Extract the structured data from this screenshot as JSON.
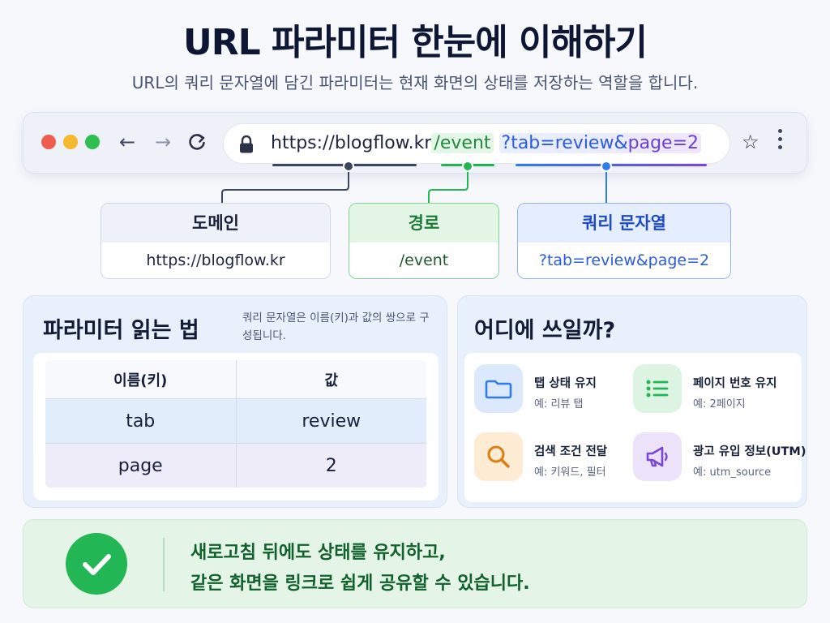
{
  "header": {
    "title": "URL 파라미터 한눈에 이해하기",
    "subtitle": "URL의 쿼리 문자열에 담긴 파라미터는 현재 화면의 상태를 저장하는 역할을 합니다."
  },
  "browser": {
    "url_domain": "https://blogflow.kr",
    "url_path": "/event",
    "url_query_start": "?tab=review&",
    "url_query_end": "page=2",
    "icons": [
      "back-arrow-icon",
      "forward-arrow-icon",
      "reload-icon",
      "lock-icon",
      "star-icon",
      "more-vert-icon"
    ]
  },
  "parts": [
    {
      "label": "도메인",
      "value": "https://blogflow.kr",
      "color": "#3d4660"
    },
    {
      "label": "경로",
      "value": "/event",
      "color": "#22b655"
    },
    {
      "label": "쿼리 문자열",
      "value": "?tab=review&page=2",
      "color": "#2f7bf0"
    }
  ],
  "reading": {
    "title": "파라미터 읽는 법",
    "note": "쿼리 문자열은 이름(키)과 값의 쌍으로 구성됩니다.",
    "columns": [
      "이름(키)",
      "값"
    ],
    "rows": [
      {
        "key": "tab",
        "value": "review"
      },
      {
        "key": "page",
        "value": "2"
      }
    ]
  },
  "usage": {
    "title": "어디에 쓰일까?",
    "items": [
      {
        "label": "탭 상태 유지",
        "example": "예: 리뷰 탭",
        "icon": "folder-icon",
        "color": "#2f7bf0"
      },
      {
        "label": "페이지 번호 유지",
        "example": "예: 2페이지",
        "icon": "list-icon",
        "color": "#22b655"
      },
      {
        "label": "검색 조건 전달",
        "example": "예: 키워드, 필터",
        "icon": "search-icon",
        "color": "#e07d12"
      },
      {
        "label": "광고 유입 정보(UTM)",
        "example": "예: utm_source",
        "icon": "megaphone-icon",
        "color": "#7b45d8"
      }
    ]
  },
  "banner": {
    "line1": "새로고침 뒤에도 상태를 유지하고,",
    "line2": "같은 화면을 링크로 쉽게 공유할 수 있습니다.",
    "icon": "check-circle-icon"
  }
}
